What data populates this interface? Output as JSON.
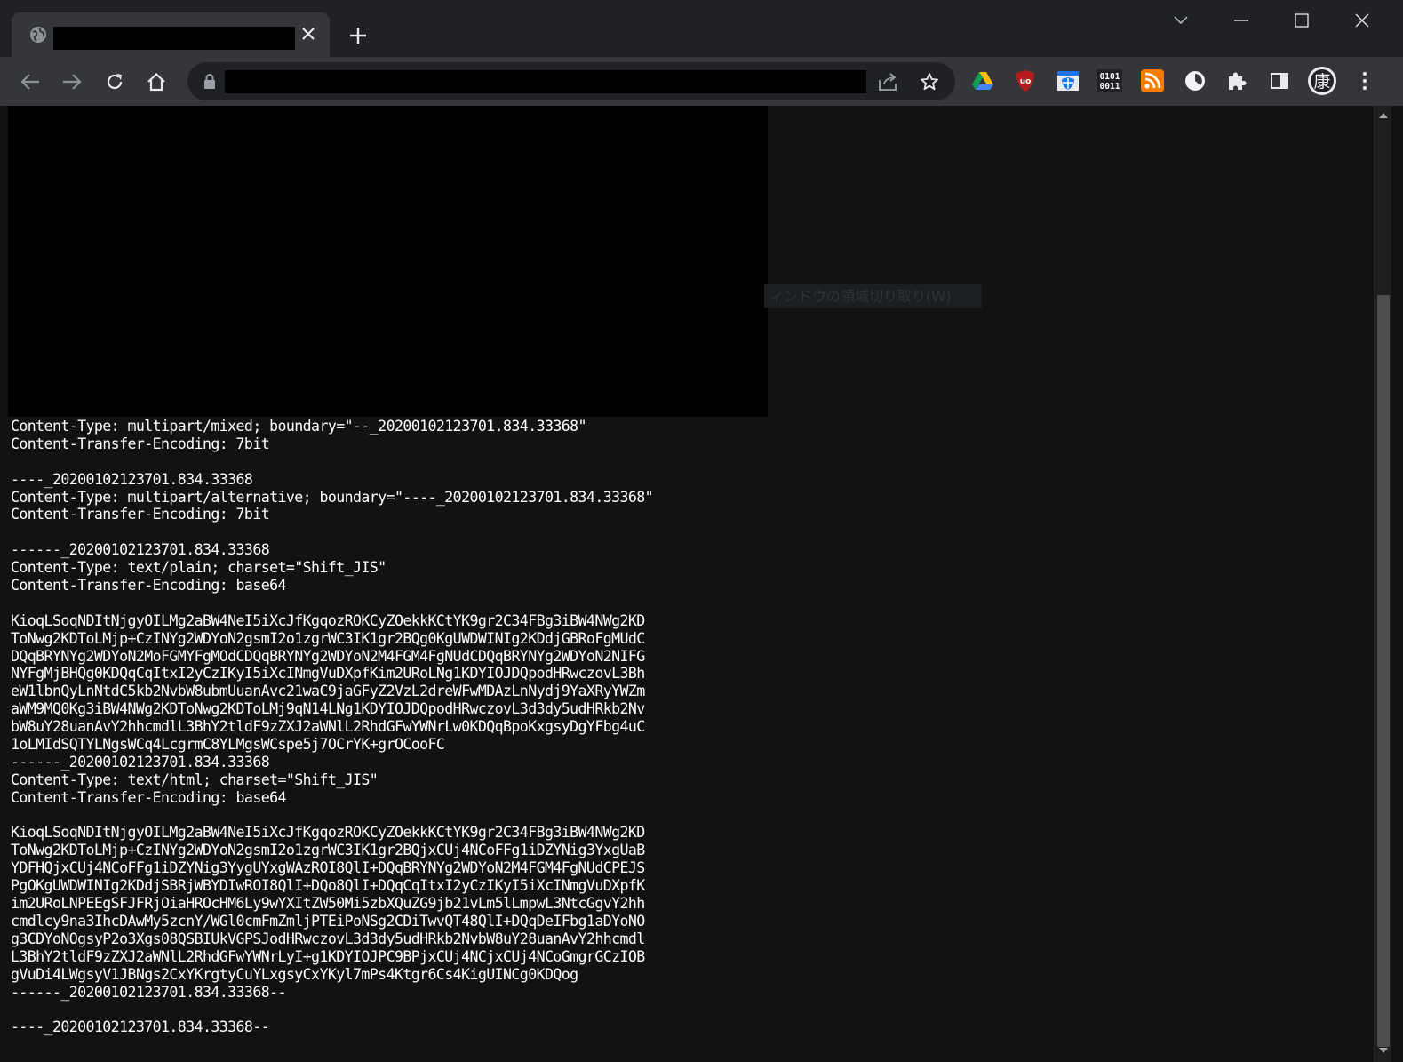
{
  "browser": {
    "tab": {
      "title": "",
      "favicon": "globe-icon",
      "close": "close-icon"
    },
    "new_tab": "plus-icon",
    "window_controls": [
      "chevron-down-icon",
      "minimize-icon",
      "maximize-icon",
      "close-icon"
    ],
    "toolbar": {
      "back": "back-arrow-icon",
      "forward": "forward-arrow-icon",
      "reload": "reload-icon",
      "home": "home-icon",
      "url": "",
      "lock": "lock-icon",
      "share": "share-icon",
      "bookmark": "star-icon"
    },
    "extensions": [
      {
        "name": "google-drive-icon"
      },
      {
        "name": "ublock-icon",
        "label": "uo"
      },
      {
        "name": "web-shield-icon"
      },
      {
        "name": "binary-icon",
        "label": "0101\n0011"
      },
      {
        "name": "rss-icon"
      },
      {
        "name": "clock-icon"
      },
      {
        "name": "puzzle-icon"
      },
      {
        "name": "side-panel-icon"
      },
      {
        "name": "profile-avatar-icon",
        "label": "康"
      },
      {
        "name": "kebab-menu-icon"
      }
    ]
  },
  "overlay_text": "ィンドウの領域切り取り(W)",
  "mail_lines": [
    "Content-Type: multipart/mixed; boundary=\"--_20200102123701.834.33368\"",
    "Content-Transfer-Encoding: 7bit",
    "",
    "----_20200102123701.834.33368",
    "Content-Type: multipart/alternative; boundary=\"----_20200102123701.834.33368\"",
    "Content-Transfer-Encoding: 7bit",
    "",
    "------_20200102123701.834.33368",
    "Content-Type: text/plain; charset=\"Shift_JIS\"",
    "Content-Transfer-Encoding: base64",
    "",
    "KioqLSoqNDItNjgyOILMg2aBW4NeI5iXcJfKgqozROKCyZOekkKCtYK9gr2C34FBg3iBW4NWg2KD",
    "ToNwg2KDToLMjp+CzINYg2WDYoN2gsmI2o1zgrWC3IK1gr2BQg0KgUWDWINIg2KDdjGBRoFgMUdC",
    "DQqBRYNYg2WDYoN2MoFGMYFgMOdCDQqBRYNYg2WDYoN2M4FGM4FgNUdCDQqBRYNYg2WDYoN2NIFG",
    "NYFgMjBHQg0KDQqCqItxI2yCzIKyI5iXcINmgVuDXpfKim2URoLNg1KDYIOJDQpodHRwczovL3Bh",
    "eW1lbnQyLnNtdC5kb2NvbW8ubmUuanAvc21waC9jaGFyZ2VzL2dreWFwMDAzLnNydj9YaXRyYWZm",
    "aWM9MQ0Kg3iBW4NWg2KDToNwg2KDToLMj9qN14LNg1KDYIOJDQpodHRwczovL3d3dy5udHRkb2Nv",
    "bW8uY28uanAvY2hhcmdlL3BhY2tldF9zZXJ2aWNlL2RhdGFwYWNrLw0KDQqBpoKxgsyDgYFbg4uC",
    "1oLMIdSQTYLNgsWCq4LcgrmC8YLMgsWCspe5j7OCrYK+grOCooFC",
    "------_20200102123701.834.33368",
    "Content-Type: text/html; charset=\"Shift_JIS\"",
    "Content-Transfer-Encoding: base64",
    "",
    "KioqLSoqNDItNjgyOILMg2aBW4NeI5iXcJfKgqozROKCyZOekkKCtYK9gr2C34FBg3iBW4NWg2KD",
    "ToNwg2KDToLMjp+CzINYg2WDYoN2gsmI2o1zgrWC3IK1gr2BQjxCUj4NCoFFg1iDZYNig3YxgUaB",
    "YDFHQjxCUj4NCoFFg1iDZYNig3YygUYxgWAzROI8QlI+DQqBRYNYg2WDYoN2M4FGM4FgNUdCPEJS",
    "PgOKgUWDWINIg2KDdjSBRjWBYDIwROI8QlI+DQo8QlI+DQqCqItxI2yCzIKyI5iXcINmgVuDXpfK",
    "im2URoLNPEEgSFJFRjOiaHROcHM6Ly9wYXItZW50Mi5zbXQuZG9jb21vLm5lLmpwL3NtcGgvY2hh",
    "cmdlcy9na3IhcDAwMy5zcnY/WGl0cmFmZmljPTEiPoNSg2CDiTwvQT48QlI+DQqDeIFbg1aDYoNO",
    "g3CDYoNOgsyP2o3Xgs08QSBIUkVGPSJodHRwczovL3d3dy5udHRkb2NvbW8uY28uanAvY2hhcmdl",
    "L3BhY2tldF9zZXJ2aWNlL2RhdGFwYWNrLyI+g1KDYIOJPC9BPjxCUj4NCjxCUj4NCoGmgrGCzIOB",
    "gVuDi4LWgsyV1JBNgs2CxYKrgtyCuYLxgsyCxYKyl7mPs4Ktgr6Cs4KigUINCg0KDQog",
    "------_20200102123701.834.33368--",
    "",
    "----_20200102123701.834.33368--"
  ]
}
